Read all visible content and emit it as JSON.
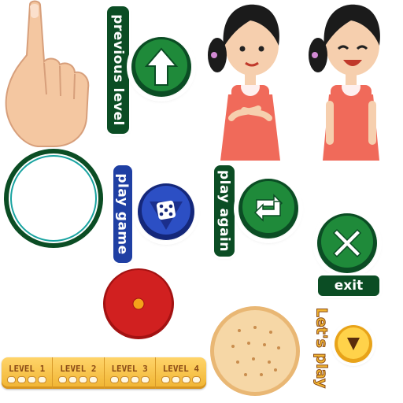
{
  "labels": {
    "previous_level": "previous level",
    "play_game": "play game",
    "play_again": "play again",
    "exit": "exit",
    "lets_play": "Let's play"
  },
  "levels": [
    "LEVEL 1",
    "LEVEL 2",
    "LEVEL 3",
    "LEVEL 4"
  ],
  "icons": {
    "pointer": "pointing-hand-icon",
    "previous": "up-arrow-icon",
    "play_game": "dice-icon",
    "play_again": "repeat-icon",
    "exit": "close-icon",
    "lets_play": "play-triangle-icon",
    "empty_frame": "ring-frame",
    "red_button": "red-dot-button",
    "cracker": "cracker-biscuit"
  },
  "colors": {
    "green_dark": "#0b4d24",
    "green": "#1f8a3a",
    "blue": "#1f3fa3",
    "red": "#d12020",
    "gold": "#f2b632",
    "biscuit": "#f3cd96"
  }
}
